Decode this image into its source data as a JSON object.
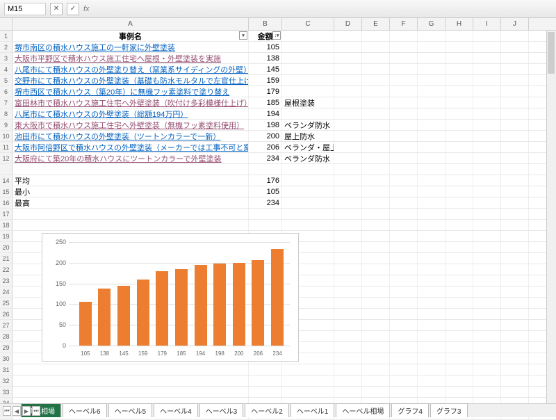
{
  "namebox": "M15",
  "columns": [
    "A",
    "B",
    "C",
    "D",
    "E",
    "F",
    "G",
    "H",
    "I",
    "J"
  ],
  "headers": {
    "A": "事例名",
    "B": "金額"
  },
  "data_rows": [
    {
      "a": "堺市南区の積水ハウス施工の一軒家に外壁塗装",
      "b": 105,
      "c": "",
      "cls": "link"
    },
    {
      "a": "大阪市平野区で積水ハウス施工住宅へ屋根・外壁塗装を実施",
      "b": 138,
      "c": "",
      "cls": "link-v"
    },
    {
      "a": "八尾市にて積水ハウスの外壁塗り替え（窯業系サイディングの外壁）",
      "b": 145,
      "c": "",
      "cls": "link"
    },
    {
      "a": "交野市にて積水ハウスの外壁塗装（基礎も防水モルタルで左官仕上げ）",
      "b": 159,
      "c": "",
      "cls": "link"
    },
    {
      "a": "堺市西区で積水ハウス（築20年）に無機フッ素塗料で塗り替え",
      "b": 179,
      "c": "",
      "cls": "link"
    },
    {
      "a": "富田林市で積水ハウス施工住宅へ外壁塗装（吹付け多彩模様仕上げ）",
      "b": 185,
      "c": "屋根塗装",
      "cls": "link-v"
    },
    {
      "a": "八尾市にて積水ハウスの外壁塗装（総額194万円）",
      "b": 194,
      "c": "",
      "cls": "link"
    },
    {
      "a": "東大阪市で積水ハウス施工住宅へ外壁塗装（無機フッ素塗料使用）",
      "b": 198,
      "c": "ベランダ防水",
      "cls": "link-v"
    },
    {
      "a": "池田市にて積水ハウスの外壁塗装（ツートンカラーで一新）",
      "b": 200,
      "c": "屋上防水",
      "cls": "link"
    },
    {
      "a": "大阪市阿倍野区で積水ハウスの外壁塗装（メーカーでは工事不可と案内）",
      "b": 206,
      "c": "ベランダ・屋上防水",
      "cls": "link"
    },
    {
      "a": "大阪府にて築20年の積水ハウスにツートンカラーで外壁塗装",
      "b": 234,
      "c": "ベランダ防水",
      "cls": "link-v"
    }
  ],
  "summary": [
    {
      "label": "平均",
      "value": 176
    },
    {
      "label": "最小",
      "value": 105
    },
    {
      "label": "最高",
      "value": 234
    }
  ],
  "chart_data": {
    "type": "bar",
    "categories": [
      105,
      138,
      145,
      159,
      179,
      185,
      194,
      198,
      200,
      206,
      234
    ],
    "values": [
      105,
      138,
      145,
      159,
      179,
      185,
      194,
      198,
      200,
      206,
      234
    ],
    "ylim": [
      0,
      250
    ],
    "yticks": [
      0,
      50,
      100,
      150,
      200,
      250
    ],
    "title": "",
    "xlabel": "",
    "ylabel": ""
  },
  "tabs": [
    "積水相場",
    "ヘーベル6",
    "ヘーベル5",
    "ヘーベル4",
    "ヘーベル3",
    "ヘーベル2",
    "ヘーベル1",
    "ヘーベル相場",
    "グラフ4",
    "グラフ3"
  ],
  "active_tab": 0
}
